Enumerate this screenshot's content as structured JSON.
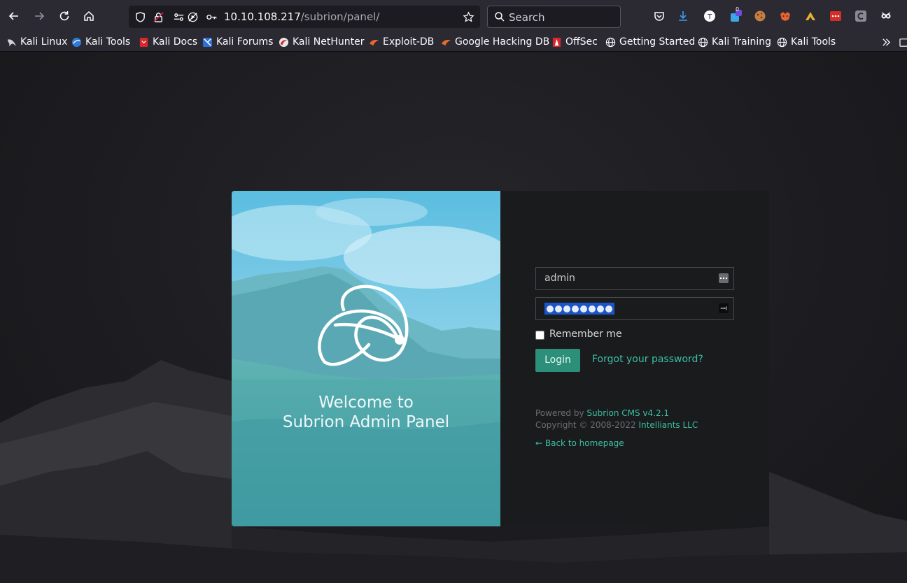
{
  "browser": {
    "url_host": "10.10.108.217",
    "url_path": "/subrion/panel/",
    "search_placeholder": "Search",
    "pocket_badge": "0"
  },
  "bookmarks": [
    {
      "label": "Kali Linux",
      "icon": "kali-dragon-icon"
    },
    {
      "label": "Kali Tools",
      "icon": "kali-tools-icon"
    },
    {
      "label": "Kali Docs",
      "icon": "kali-docs-icon"
    },
    {
      "label": "Kali Forums",
      "icon": "kali-forums-icon"
    },
    {
      "label": "Kali NetHunter",
      "icon": "nethunter-icon"
    },
    {
      "label": "Exploit-DB",
      "icon": "exploit-db-icon"
    },
    {
      "label": "Google Hacking DB",
      "icon": "ghdb-icon"
    },
    {
      "label": "OffSec",
      "icon": "offsec-icon"
    },
    {
      "label": "Getting Started",
      "icon": "globe-icon"
    },
    {
      "label": "Kali Training",
      "icon": "globe-icon"
    },
    {
      "label": "Kali Tools",
      "icon": "globe-icon"
    }
  ],
  "panel": {
    "welcome_line1": "Welcome to",
    "welcome_line2": "Subrion Admin Panel",
    "username_value": "admin",
    "remember_label": "Remember me",
    "login_label": "Login",
    "forgot_label": "Forgot your password?",
    "powered_prefix": "Powered by ",
    "powered_link": "Subrion CMS v4.2.1",
    "copyright_prefix": "Copyright © 2008-2022 ",
    "copyright_link": "Intelliants LLC",
    "back_label": "← Back to homepage"
  },
  "colors": {
    "accent": "#2b8f7a",
    "link": "#3cbfa3",
    "toolbar": "#2b2a33"
  }
}
